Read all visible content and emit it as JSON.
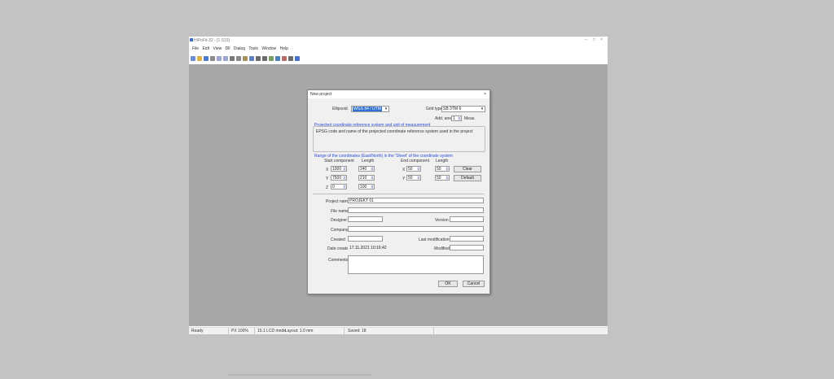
{
  "app": {
    "title": "HiPoFit-32 - [1 S19]",
    "menu": [
      "File",
      "Edit",
      "View",
      "Dll",
      "Dialog",
      "Tools",
      "Window",
      "Help"
    ],
    "window_controls": [
      "–",
      "□",
      "×"
    ]
  },
  "status": {
    "left": "Ready",
    "cells": [
      "PX 100%",
      "15.1 LCD mode",
      "Layout: 1.0 mm",
      "Saved: 18"
    ]
  },
  "dialog": {
    "title": "New project",
    "close": "×",
    "body_label": "Ellipsoid",
    "body_value": "WGS 84 / UTM",
    "grid_label": "Grid type",
    "grid_value": "SB 3TM 6",
    "add_label": "Add. area",
    "add_value": "1",
    "add_unit": "Meas.",
    "desc_header": "Projected coordinate reference system and unit of measurement",
    "desc_text": "EPSG code and name of the projected coordinate reference system used in the project",
    "coord_header": "Range of the coordinates (East/North) in the 'Sheet' of the coordinate system",
    "cols": {
      "start": "Start component",
      "len1": "Length",
      "end": "End component",
      "len2": "Length"
    },
    "rows": [
      {
        "axis": "X",
        "start": "1000",
        "len1": "240",
        "end": "50",
        "len2": "50"
      },
      {
        "axis": "Y",
        "start": "7500",
        "len1": "210",
        "end": "50",
        "len2": "50"
      },
      {
        "axis": "Z",
        "start": "0",
        "len1": "100"
      }
    ],
    "clear_btn": "Clear",
    "default_btn": "Default",
    "fields": {
      "project_label": "Project name",
      "project_value": "PROJEKT 01",
      "filename_label": "File name",
      "filename_value": "",
      "designer_label": "Designer",
      "designer_value": "",
      "version_label": "Version",
      "version_value": "",
      "company_label": "Company",
      "company_value": "",
      "created_label": "Created",
      "created_value": "",
      "lastmod_label": "Last modification",
      "lastmod_value": "",
      "datecreated_label": "Date created",
      "datecreated_value": "17.11.2021 10:16:42",
      "modified_label": "Modified",
      "modified_value": "",
      "comments_label": "Comments"
    },
    "ok_btn": "OK",
    "cancel_btn": "Cancel"
  },
  "colors": {
    "workspace": "#a8a8a8",
    "desktop": "#c3c3c3",
    "selection": "#2f6fd1",
    "link": "#2a4bd7"
  },
  "toolbar_icons": [
    "new-icon",
    "open-icon",
    "save-icon",
    "print-icon",
    "undo-icon",
    "redo-icon",
    "cut-icon",
    "copy-icon",
    "paste-icon",
    "find-icon",
    "zoom-in-icon",
    "zoom-out-icon",
    "grid-icon",
    "layer-icon",
    "measure-icon",
    "settings-icon",
    "help-icon"
  ]
}
